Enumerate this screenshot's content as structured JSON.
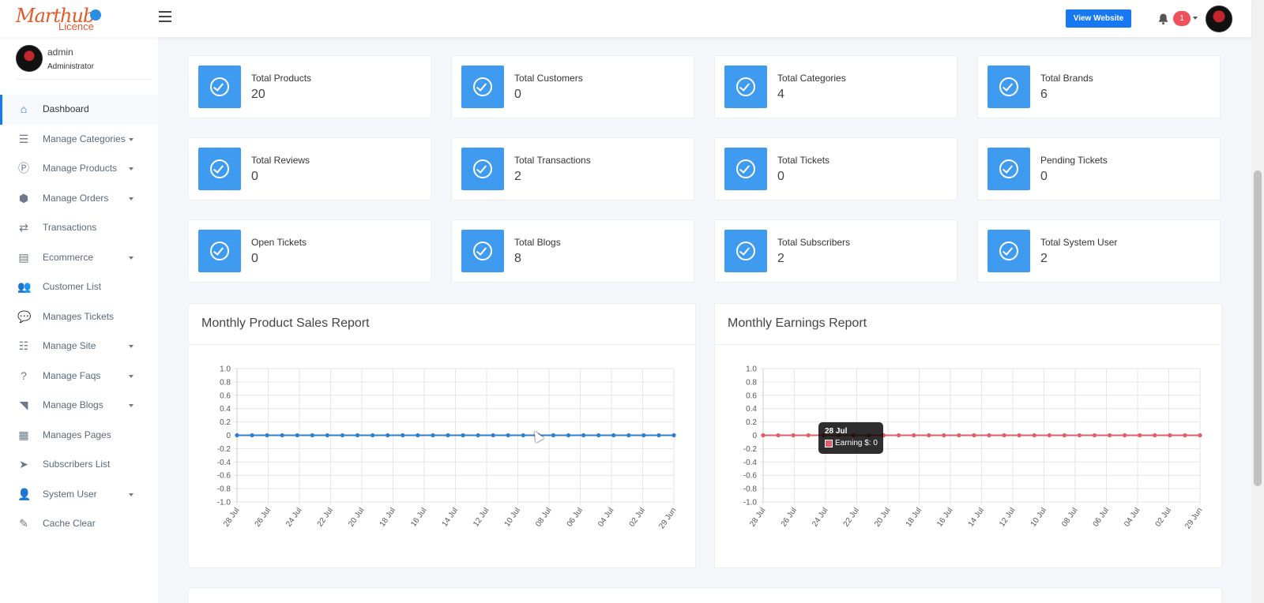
{
  "header": {
    "logo_main": "Marthub",
    "logo_sub": "Licence",
    "view_website_label": "View Website",
    "notification_count": "1"
  },
  "user": {
    "name": "admin",
    "role": "Administrator"
  },
  "sidebar": {
    "items": [
      {
        "label": "Dashboard",
        "icon": "home-icon",
        "glyph": "⌂",
        "active": true,
        "has_caret": false
      },
      {
        "label": "Manage Categories",
        "icon": "list-icon",
        "glyph": "☰",
        "active": false,
        "has_caret": true
      },
      {
        "label": "Manage Products",
        "icon": "product-icon",
        "glyph": "Ⓟ",
        "active": false,
        "has_caret": true
      },
      {
        "label": "Manage Orders",
        "icon": "box-icon",
        "glyph": "⬢",
        "active": false,
        "has_caret": true
      },
      {
        "label": "Transactions",
        "icon": "shuffle-icon",
        "glyph": "⇄",
        "active": false,
        "has_caret": false
      },
      {
        "label": "Ecommerce",
        "icon": "cart-icon",
        "glyph": "▤",
        "active": false,
        "has_caret": true
      },
      {
        "label": "Customer List",
        "icon": "users-icon",
        "glyph": "👥",
        "active": false,
        "has_caret": false
      },
      {
        "label": "Manages Tickets",
        "icon": "comments-icon",
        "glyph": "💬",
        "active": false,
        "has_caret": false
      },
      {
        "label": "Manage Site",
        "icon": "tasks-icon",
        "glyph": "☷",
        "active": false,
        "has_caret": true
      },
      {
        "label": "Manage Faqs",
        "icon": "question-icon",
        "glyph": "?",
        "active": false,
        "has_caret": true
      },
      {
        "label": "Manage Blogs",
        "icon": "rss-icon",
        "glyph": "◥",
        "active": false,
        "has_caret": true
      },
      {
        "label": "Manages Pages",
        "icon": "page-icon",
        "glyph": "▦",
        "active": false,
        "has_caret": false
      },
      {
        "label": "Subscribers List",
        "icon": "send-icon",
        "glyph": "➤",
        "active": false,
        "has_caret": false
      },
      {
        "label": "System User",
        "icon": "user-icon",
        "glyph": "👤",
        "active": false,
        "has_caret": true
      },
      {
        "label": "Cache Clear",
        "icon": "broom-icon",
        "glyph": "✎",
        "active": false,
        "has_caret": false
      }
    ]
  },
  "stats": [
    {
      "label": "Total Products",
      "value": "20"
    },
    {
      "label": "Total Customers",
      "value": "0"
    },
    {
      "label": "Total Categories",
      "value": "4"
    },
    {
      "label": "Total Brands",
      "value": "6"
    },
    {
      "label": "Total Reviews",
      "value": "0"
    },
    {
      "label": "Total Transactions",
      "value": "2"
    },
    {
      "label": "Total Tickets",
      "value": "0"
    },
    {
      "label": "Pending Tickets",
      "value": "0"
    },
    {
      "label": "Open Tickets",
      "value": "0"
    },
    {
      "label": "Total Blogs",
      "value": "8"
    },
    {
      "label": "Total Subscribers",
      "value": "2"
    },
    {
      "label": "Total System User",
      "value": "2"
    }
  ],
  "panels": {
    "sales_title": "Monthly Product Sales Report",
    "earnings_title": "Monthly Earnings Report"
  },
  "tooltip": {
    "title": "28 Jul",
    "text": "Earning $: 0"
  },
  "chart_data": [
    {
      "type": "line",
      "title": "Monthly Product Sales Report",
      "x_tick_labels": [
        "28 Jul",
        "26 Jul",
        "24 Jul",
        "22 Jul",
        "20 Jul",
        "18 Jul",
        "16 Jul",
        "14 Jul",
        "12 Jul",
        "10 Jul",
        "08 Jul",
        "06 Jul",
        "04 Jul",
        "02 Jul",
        "29 Jun"
      ],
      "point_count": 30,
      "series": [
        {
          "values": [
            0,
            0,
            0,
            0,
            0,
            0,
            0,
            0,
            0,
            0,
            0,
            0,
            0,
            0,
            0,
            0,
            0,
            0,
            0,
            0,
            0,
            0,
            0,
            0,
            0,
            0,
            0,
            0,
            0,
            0
          ],
          "color": "#2f7fd0"
        }
      ],
      "y_ticks": [
        "1.0",
        "0.8",
        "0.6",
        "0.4",
        "0.2",
        "0",
        "-0.2",
        "-0.4",
        "-0.6",
        "-0.8",
        "-1.0"
      ],
      "ylim": [
        -1.0,
        1.0
      ],
      "grid": true
    },
    {
      "type": "line",
      "title": "Monthly Earnings Report",
      "x_tick_labels": [
        "28 Jul",
        "26 Jul",
        "24 Jul",
        "22 Jul",
        "20 Jul",
        "18 Jul",
        "16 Jul",
        "14 Jul",
        "12 Jul",
        "10 Jul",
        "08 Jul",
        "06 Jul",
        "04 Jul",
        "02 Jul",
        "29 Jun"
      ],
      "point_count": 30,
      "series": [
        {
          "name": "Earning $",
          "values": [
            0,
            0,
            0,
            0,
            0,
            0,
            0,
            0,
            0,
            0,
            0,
            0,
            0,
            0,
            0,
            0,
            0,
            0,
            0,
            0,
            0,
            0,
            0,
            0,
            0,
            0,
            0,
            0,
            0,
            0
          ],
          "color": "#e05d6a"
        }
      ],
      "y_ticks": [
        "1.0",
        "0.8",
        "0.6",
        "0.4",
        "0.2",
        "0",
        "-0.2",
        "-0.4",
        "-0.6",
        "-0.8",
        "-1.0"
      ],
      "ylim": [
        -1.0,
        1.0
      ],
      "grid": true
    }
  ]
}
